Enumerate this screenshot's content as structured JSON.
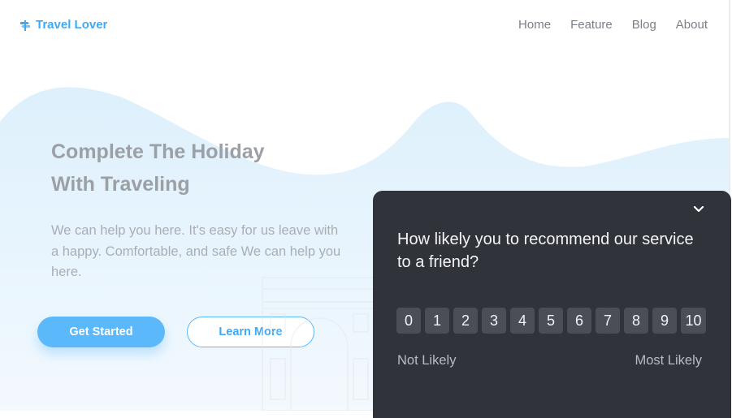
{
  "brand": {
    "name": "Travel Lover",
    "logo_icon": "signpost-icon",
    "accent": "#3fa9f5"
  },
  "nav": {
    "items": [
      "Home",
      "Feature",
      "Blog",
      "About"
    ]
  },
  "hero": {
    "title_line1": "Complete The Holiday",
    "title_line2": "With Traveling",
    "description": "We can help you here. It's easy for us leave with a happy. Comfortable, and safe We can help you here.",
    "primary_button": "Get Started",
    "secondary_button": "Learn More"
  },
  "survey": {
    "close_icon": "chevron-down-icon",
    "question": "How likely you to recommend our service to a friend?",
    "scale": [
      "0",
      "1",
      "2",
      "3",
      "4",
      "5",
      "6",
      "7",
      "8",
      "9",
      "10"
    ],
    "low_label": "Not Likely",
    "high_label": "Most Likely",
    "background": "#30333a"
  }
}
